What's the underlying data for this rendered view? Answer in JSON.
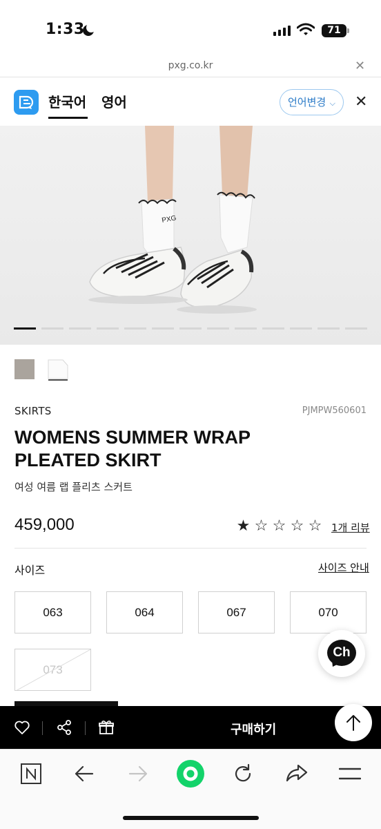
{
  "status_bar": {
    "time": "1:33",
    "battery": "71"
  },
  "browser": {
    "url": "pxg.co.kr"
  },
  "language_bar": {
    "tabs": [
      {
        "label": "한국어",
        "active": true
      },
      {
        "label": "영어",
        "active": false
      }
    ],
    "change_button": "언어변경",
    "accent": "#2d9bf0"
  },
  "gallery": {
    "total": 13,
    "active_index": 0
  },
  "swatches": [
    {
      "name": "gray",
      "color": "#aaa49d"
    },
    {
      "name": "white",
      "color": "#ffffff"
    }
  ],
  "product": {
    "category": "SKIRTS",
    "sku": "PJMPW560601",
    "title_line1": "WOMENS SUMMER WRAP",
    "title_line2": "PLEATED SKIRT",
    "subtitle": "여성 여름 랩 플리츠 스커트",
    "price": "459,000",
    "rating": 1,
    "rating_max": 5,
    "reviews_link": "1개 리뷰"
  },
  "size_section": {
    "label": "사이즈",
    "guide_link": "사이즈 안내",
    "options": [
      {
        "label": "063",
        "available": true
      },
      {
        "label": "064",
        "available": true
      },
      {
        "label": "067",
        "available": true
      },
      {
        "label": "070",
        "available": true
      },
      {
        "label": "073",
        "available": false
      }
    ]
  },
  "chat": {
    "label": "Ch"
  },
  "action_bar": {
    "buy_label": "구매하기"
  },
  "icons": {
    "action_bar": [
      "heart-icon",
      "share-icon",
      "gift-icon"
    ],
    "browser_toolbar": [
      "naver-n-icon",
      "back-arrow-icon",
      "forward-arrow-icon",
      "green-home-icon",
      "reload-icon",
      "share-arrow-icon",
      "menu-icon"
    ]
  }
}
